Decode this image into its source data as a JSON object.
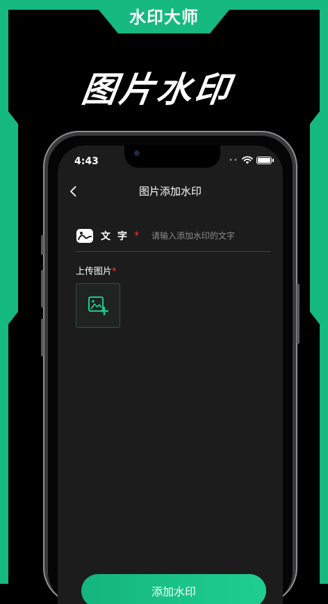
{
  "banner": {
    "title": "水印大师"
  },
  "hero": {
    "title": "图片水印"
  },
  "status_bar": {
    "time": "4:43",
    "icons": [
      "signal-dots-icon",
      "wifi-icon",
      "battery-icon"
    ]
  },
  "nav": {
    "title": "图片添加水印",
    "back_icon": "chevron-left-icon"
  },
  "text_field": {
    "icon": "image-icon",
    "label": "文字",
    "required_mark": "*",
    "value": "",
    "placeholder": "请输入添加水印的文字"
  },
  "upload": {
    "label": "上传图片",
    "required_mark": "*",
    "icon": "add-image-icon"
  },
  "submit": {
    "label": "添加水印"
  },
  "colors": {
    "accent": "#16B97F",
    "background": "#000000",
    "screen": "#1C1C1C",
    "required": "#FF3B30"
  }
}
